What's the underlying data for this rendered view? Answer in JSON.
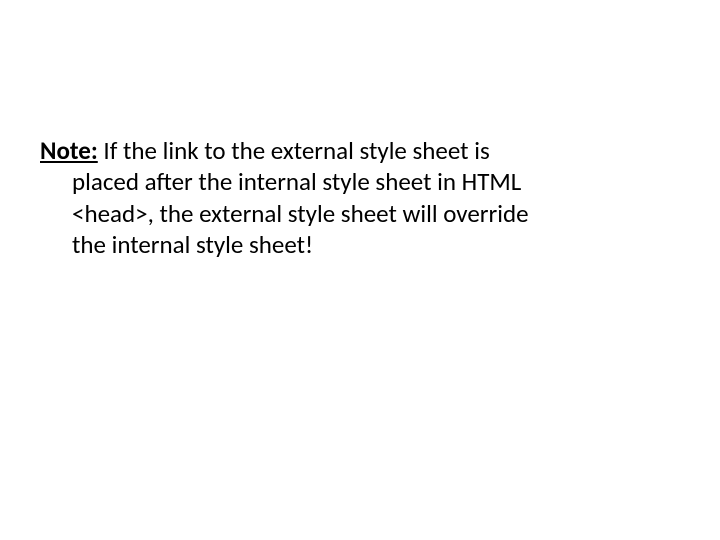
{
  "note": {
    "label": "Note:",
    "line1_rest": " If the link to the external style sheet is",
    "line2": "placed after the internal style sheet in HTML",
    "line3": "<head>, the external style sheet will override",
    "line4": "the internal style sheet!"
  }
}
